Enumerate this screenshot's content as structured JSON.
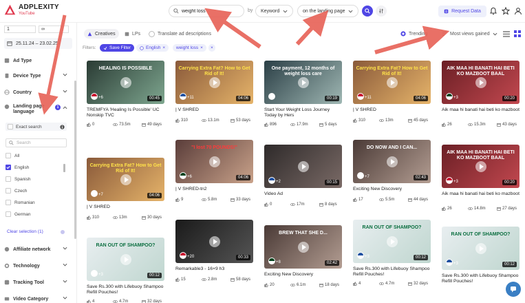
{
  "app": {
    "name": "ADPLEXITY",
    "sub": "YouTube"
  },
  "search": {
    "value": "weight loss",
    "by": "by",
    "field": "Keyword",
    "scope": "on the landing page"
  },
  "header": {
    "request_label": "Request Data"
  },
  "sidebar": {
    "num_min": "1",
    "num_max": "∞",
    "date_range": "25.11.24 – 23.02.25",
    "sections": {
      "ad_type": "Ad Type",
      "device_type": "Device Type",
      "country": "Country",
      "landing_page_language": "Landing page language",
      "landing_count": "1",
      "affiliate": "Affiliate network",
      "technology": "Technology",
      "tracking": "Tracking Tool",
      "video_category": "Video Category"
    },
    "exact_search": "Exact search",
    "search_placeholder": "Search",
    "languages": [
      {
        "label": "All",
        "checked": false
      },
      {
        "label": "English",
        "checked": true
      },
      {
        "label": "Spanish",
        "checked": false
      },
      {
        "label": "Czech",
        "checked": false
      },
      {
        "label": "Romanian",
        "checked": false
      },
      {
        "label": "German",
        "checked": false
      }
    ],
    "clear_selection": "Clear selection (1)"
  },
  "toolbar": {
    "tab_creatives": "Creatives",
    "tab_lps": "LPs",
    "translate": "Translate ad descriptions",
    "trending": "Trending",
    "sort": "Most views gained"
  },
  "filters": {
    "label": "Filters:",
    "save": "Save Filter",
    "chip_lang": "English",
    "chip_keyword": "weight loss"
  },
  "colors": {
    "accent": "#4f46e5",
    "brand": "#e0374c"
  },
  "cards": [
    {
      "title": "TREMFYA 'Healing Is Possible' UC Nonskip TVC",
      "likes": "0",
      "views": "73.5m",
      "days": "49 days",
      "duration": "00:45",
      "thumb_text": "HEALING IS POSSIBLE",
      "plus": "+6"
    },
    {
      "title": "| V SHRED",
      "likes": "310",
      "views": "13m",
      "days": "30 days",
      "duration": "04:06",
      "thumb_text": "Carrying Extra Fat? How to Get Rid of It!",
      "plus": "+7"
    },
    {
      "title": "| V SHRED",
      "likes": "310",
      "views": "13.1m",
      "days": "53 days",
      "duration": "04:06",
      "thumb_text": "Carrying Extra Fat? How to Get Rid of It!",
      "plus": "+11"
    },
    {
      "title": "| V SHRED-tn2",
      "likes": "9",
      "views": "5.8m",
      "days": "33 days",
      "duration": "04:06",
      "thumb_text": "\"I lost 70 POUNDS!\"",
      "plus": "+6"
    },
    {
      "title": "Remarkable3 - 16×9 h3",
      "likes": "15",
      "views": "2.8m",
      "days": "58 days",
      "duration": "00:33",
      "thumb_text": "",
      "plus": "+20"
    },
    {
      "title": "Start Your Weight Loss Journey Today by Hers",
      "likes": "896",
      "views": "17.9m",
      "days": "5 days",
      "duration": "00:19",
      "thumb_text": "One payment, 12 months of weight loss care",
      "plus": ""
    },
    {
      "title": "Video Ad",
      "likes": "0",
      "views": "17m",
      "days": "8 days",
      "duration": "00:15",
      "thumb_text": "",
      "plus": "+2"
    },
    {
      "title": "Exciting New Discovery",
      "likes": "20",
      "views": "6.1m",
      "days": "18 days",
      "duration": "02:42",
      "thumb_text": "BREW THAT SHE D...",
      "plus": "+8"
    },
    {
      "title": "| V SHRED",
      "likes": "310",
      "views": "13m",
      "days": "45 days",
      "duration": "04:06",
      "thumb_text": "Carrying Extra Fat? How to Get Rid of It!",
      "plus": "+11"
    },
    {
      "title": "Exciting New Discovery",
      "likes": "17",
      "views": "5.5m",
      "days": "44 days",
      "duration": "02:43",
      "thumb_text": "DO NOW AND I CAN...",
      "plus": "+7"
    },
    {
      "title": "Save Rs.300 with Lifebuoy Shampoo Refill Pouches!",
      "likes": "4",
      "views": "4.7m",
      "days": "32 days",
      "duration": "00:12",
      "thumb_text": "RAN OUT OF SHAMPOO?",
      "plus": "+3"
    },
    {
      "title": "Aik maa hi banati hai beti ko mazboot",
      "likes": "26",
      "views": "15.3m",
      "days": "43 days",
      "duration": "00:20",
      "thumb_text": "AIK MAA HI BANATI HAI BETI KO MAZBOOT BAAL",
      "plus": "+3"
    },
    {
      "title": "Aik maa hi banati hai beti ko mazboot",
      "likes": "26",
      "views": "14.8m",
      "days": "27 days",
      "duration": "00:20",
      "thumb_text": "AIK MAA HI BANATI HAI BETI KO MAZBOOT BAAL",
      "plus": "+3"
    },
    {
      "title": "Save Rs.300 with Lifebuoy Shampoo Refill Pouches!",
      "likes": "4",
      "views": "4.7m",
      "days": "32 days",
      "duration": "00:12",
      "thumb_text": "RAN OUT OF SHAMPOO?",
      "plus": "+3"
    },
    {
      "title": "Save Rs.300 with Lifebuoy Shampoo Refill Pouches!",
      "likes": "",
      "views": "",
      "days": "",
      "duration": "00:12",
      "thumb_text": "RAN OUT OF SHAMPOO?",
      "plus": "+3"
    }
  ]
}
